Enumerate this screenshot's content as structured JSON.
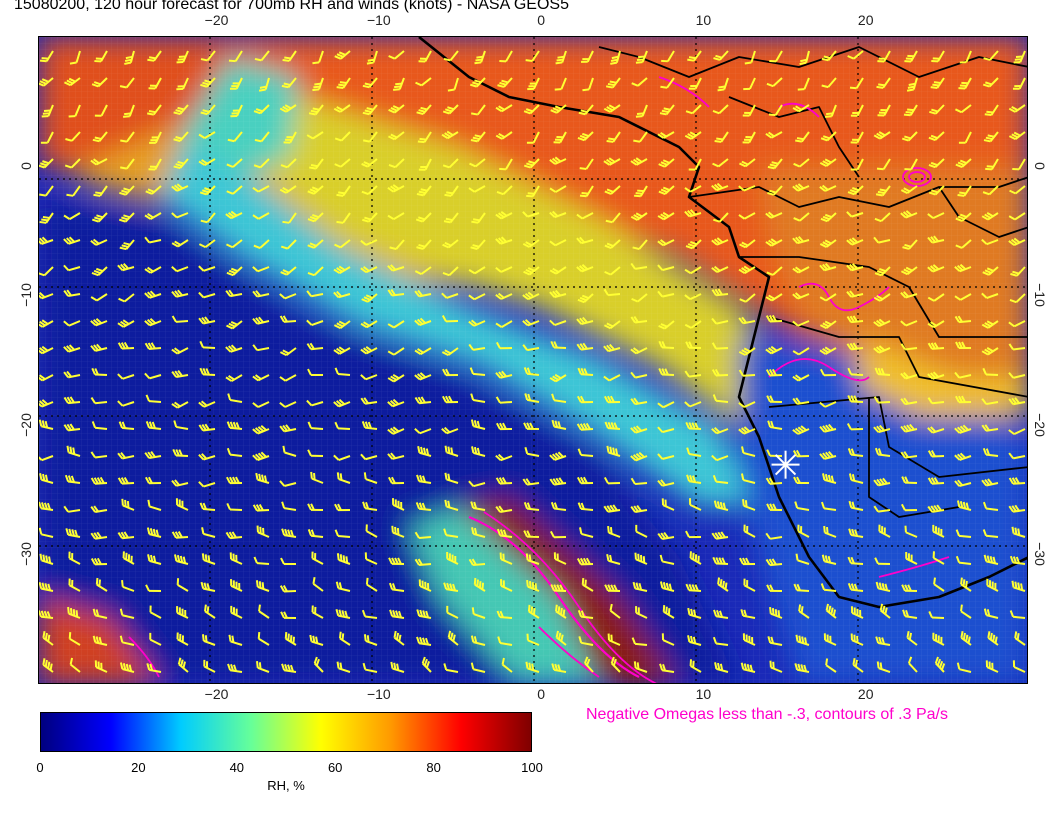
{
  "title": "15080200, 120 hour forecast for 700mb RH and winds (knots) - NASA GEOS5",
  "map": {
    "projection": "lat-lon",
    "lon_range": [
      -31,
      30
    ],
    "lat_range": [
      -40,
      10
    ],
    "lon_ticks": [
      {
        "value": -20,
        "label": "−20"
      },
      {
        "value": -10,
        "label": "−10"
      },
      {
        "value": 0,
        "label": "0"
      },
      {
        "value": 10,
        "label": "10"
      },
      {
        "value": 20,
        "label": "20"
      }
    ],
    "lat_ticks": [
      {
        "value": 0,
        "label": "0"
      },
      {
        "value": -10,
        "label": "−10"
      },
      {
        "value": -20,
        "label": "−20"
      },
      {
        "value": -30,
        "label": "−30"
      }
    ],
    "marker": {
      "type": "star",
      "lon": 15,
      "lat": -23,
      "color": "#ffffff"
    },
    "wind_barb_color": "#ffff33",
    "omega_contour_color": "#ff00cc",
    "coastline_color": "#000000"
  },
  "omega_note": "Negative Omegas less than -.3, contours of .3 Pa/s",
  "colorbar": {
    "title": "RH, %",
    "ticks": [
      {
        "value": 0,
        "label": "0"
      },
      {
        "value": 20,
        "label": "20"
      },
      {
        "value": 40,
        "label": "40"
      },
      {
        "value": 60,
        "label": "60"
      },
      {
        "value": 80,
        "label": "80"
      },
      {
        "value": 100,
        "label": "100"
      }
    ],
    "stops": [
      "#00007f",
      "#0000ff",
      "#00ccff",
      "#66ff99",
      "#ffff00",
      "#ff9900",
      "#ff0000",
      "#7f0000"
    ]
  }
}
